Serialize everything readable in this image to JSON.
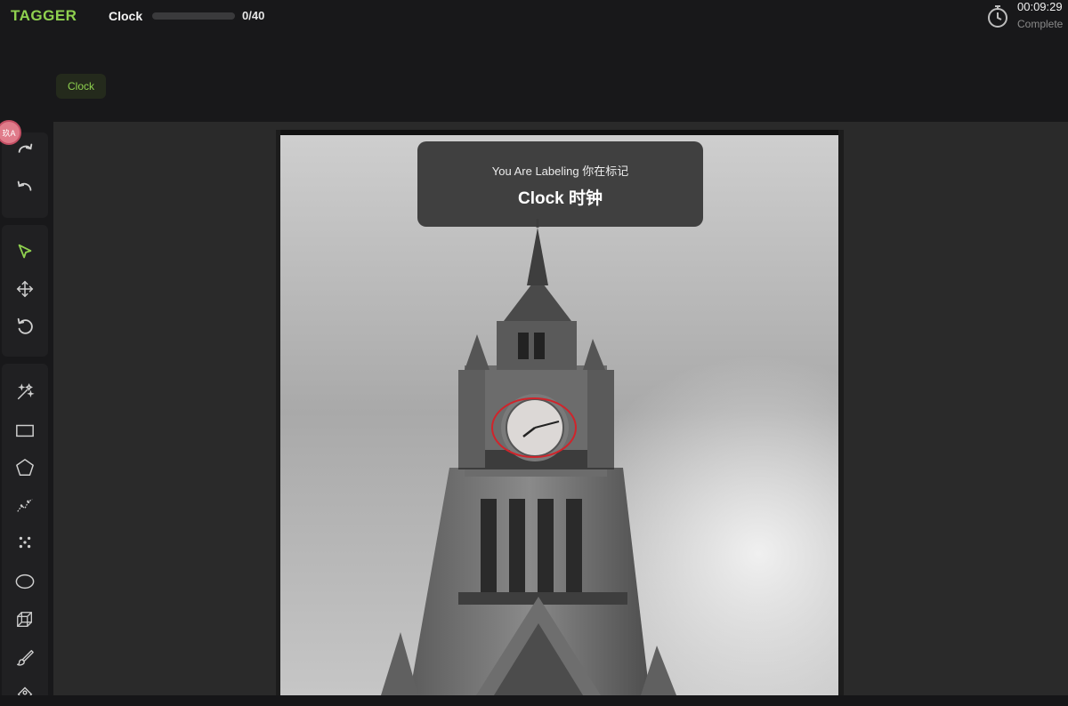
{
  "app": {
    "logo": "TAGGER"
  },
  "task": {
    "name": "Clock",
    "progress_label": "0/40",
    "progress_fraction": 0.0
  },
  "timer": {
    "time": "00:09:29",
    "status": "Complete"
  },
  "classes": [
    {
      "label": "Clock"
    }
  ],
  "banner": {
    "line1": "You Are Labeling  你在标记",
    "line2": "Clock 时钟"
  },
  "avatar": {
    "initials": "玖A"
  },
  "tools": {
    "history": [
      {
        "name": "redo-icon"
      },
      {
        "name": "undo-icon"
      }
    ],
    "navigation": [
      {
        "name": "select-arrow-icon"
      },
      {
        "name": "move-icon"
      },
      {
        "name": "rotate-icon"
      }
    ],
    "annotation": [
      {
        "name": "magic-wand-icon"
      },
      {
        "name": "rectangle-icon"
      },
      {
        "name": "polygon-icon"
      },
      {
        "name": "polyline-icon"
      },
      {
        "name": "keypoints-icon"
      },
      {
        "name": "ellipse-icon"
      },
      {
        "name": "cuboid-icon"
      },
      {
        "name": "brush-icon"
      },
      {
        "name": "eraser-icon"
      }
    ]
  },
  "colors": {
    "accent": "#8fd14f",
    "annotation": "#d0242b",
    "panel": "#18181a",
    "workspace": "#2a2a2a"
  }
}
